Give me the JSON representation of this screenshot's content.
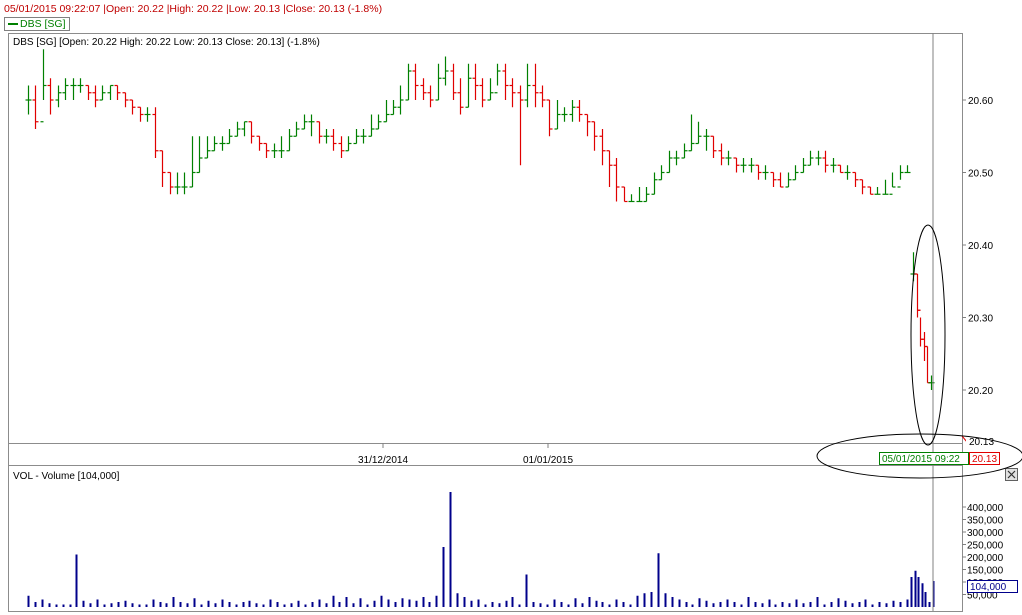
{
  "header": {
    "status_line": "05/01/2015 09:22:07 |Open: 20.22 |High: 20.22 |Low: 20.13 |Close: 20.13 (-1.8%)",
    "legend_label": "DBS [SG]"
  },
  "price_pane": {
    "info": "DBS [SG] [Open: 20.22  High: 20.22  Low: 20.13  Close: 20.13] (-1.8%)",
    "last_price_label": "20.13",
    "cursor_price_label": "20.13",
    "cursor_time_label": "05/01/2015 09:22"
  },
  "volume_pane": {
    "info": "VOL - Volume [104,000]",
    "last_volume_label": "104,000"
  },
  "colors": {
    "up": "#008000",
    "down": "#e00000",
    "volume": "#00008b",
    "annotation": "#000000"
  },
  "chart_data": [
    {
      "type": "ohlc",
      "title": "DBS [SG]",
      "ylim": [
        20.13,
        20.67
      ],
      "yticks": [
        "20.60",
        "20.50",
        "20.40",
        "20.30",
        "20.20",
        "20.13"
      ],
      "x_labels": [
        "31/12/2014",
        "01/01/2015"
      ],
      "session_1": {
        "closes": [
          20.6,
          20.57,
          20.62,
          20.6,
          20.61,
          20.62,
          20.62,
          20.62,
          20.61,
          20.6,
          20.61,
          20.62,
          20.61,
          20.6,
          20.59,
          20.58,
          20.58,
          20.53,
          20.5,
          20.48,
          20.48,
          20.48,
          20.5,
          20.52,
          20.53,
          20.54,
          20.54,
          20.55,
          20.56,
          20.57,
          20.55,
          20.54,
          20.53,
          20.53,
          20.53,
          20.55,
          20.56,
          20.57,
          20.57,
          20.55,
          20.55,
          20.54,
          20.53,
          20.54,
          20.55,
          20.55,
          20.56,
          20.57,
          20.58,
          20.59,
          20.6,
          20.64,
          20.62,
          20.61,
          20.6,
          20.63,
          20.64,
          20.61,
          20.59,
          20.63,
          20.62,
          20.6,
          20.61,
          20.64,
          20.62,
          20.61,
          20.6,
          20.62,
          20.61,
          20.6,
          20.56,
          20.58,
          20.58,
          20.59,
          20.58,
          20.57,
          20.55,
          20.53,
          20.51,
          20.48,
          20.46,
          20.46,
          20.46,
          20.47,
          20.49,
          20.5,
          20.52,
          20.52,
          20.53,
          20.54,
          20.55,
          20.55,
          20.53,
          20.52,
          20.52,
          20.51,
          20.51,
          20.51,
          20.5,
          20.5,
          20.49,
          20.48,
          20.49,
          20.5,
          20.51,
          20.52,
          20.52,
          20.51,
          20.51,
          20.5,
          20.5,
          20.49,
          20.48,
          20.47,
          20.47,
          20.47,
          20.48,
          20.5,
          20.5
        ],
        "highs": [
          20.62,
          20.62,
          20.67,
          20.63,
          20.62,
          20.63,
          20.63,
          20.63,
          20.62,
          20.62,
          20.62,
          20.62,
          20.62,
          20.61,
          20.6,
          20.59,
          20.59,
          20.59,
          20.53,
          20.5,
          20.5,
          20.5,
          20.55,
          20.55,
          20.55,
          20.55,
          20.55,
          20.56,
          20.57,
          20.57,
          20.57,
          20.55,
          20.54,
          20.54,
          20.55,
          20.56,
          20.57,
          20.58,
          20.58,
          20.57,
          20.56,
          20.56,
          20.55,
          20.55,
          20.56,
          20.56,
          20.58,
          20.58,
          20.6,
          20.6,
          20.62,
          20.65,
          20.65,
          20.63,
          20.62,
          20.65,
          20.66,
          20.65,
          20.63,
          20.65,
          20.65,
          20.63,
          20.63,
          20.65,
          20.65,
          20.63,
          20.62,
          20.65,
          20.65,
          20.62,
          20.6,
          20.6,
          20.59,
          20.6,
          20.6,
          20.58,
          20.57,
          20.56,
          20.53,
          20.52,
          20.48,
          20.47,
          20.48,
          20.48,
          20.5,
          20.51,
          20.53,
          20.53,
          20.54,
          20.58,
          20.57,
          20.56,
          20.55,
          20.54,
          20.53,
          20.52,
          20.52,
          20.52,
          20.51,
          20.51,
          20.5,
          20.5,
          20.5,
          20.51,
          20.52,
          20.53,
          20.53,
          20.53,
          20.52,
          20.51,
          20.51,
          20.5,
          20.49,
          20.48,
          20.48,
          20.49,
          20.5,
          20.51,
          20.51
        ],
        "lows": [
          20.58,
          20.56,
          20.6,
          20.58,
          20.59,
          20.6,
          20.6,
          20.61,
          20.6,
          20.59,
          20.6,
          20.6,
          20.6,
          20.59,
          20.58,
          20.57,
          20.57,
          20.52,
          20.48,
          20.47,
          20.47,
          20.47,
          20.48,
          20.5,
          20.52,
          20.53,
          20.53,
          20.54,
          20.55,
          20.55,
          20.54,
          20.53,
          20.52,
          20.52,
          20.52,
          20.53,
          20.55,
          20.56,
          20.55,
          20.54,
          20.54,
          20.53,
          20.52,
          20.53,
          20.54,
          20.54,
          20.55,
          20.56,
          20.57,
          20.58,
          20.58,
          20.6,
          20.6,
          20.6,
          20.59,
          20.6,
          20.62,
          20.6,
          20.58,
          20.59,
          20.6,
          20.59,
          20.6,
          20.62,
          20.6,
          20.59,
          20.51,
          20.59,
          20.59,
          20.59,
          20.55,
          20.56,
          20.57,
          20.57,
          20.57,
          20.55,
          20.53,
          20.51,
          20.48,
          20.46,
          20.46,
          20.46,
          20.46,
          20.46,
          20.47,
          20.49,
          20.5,
          20.51,
          20.52,
          20.53,
          20.54,
          20.53,
          20.52,
          20.51,
          20.51,
          20.5,
          20.5,
          20.5,
          20.49,
          20.49,
          20.48,
          20.48,
          20.48,
          20.49,
          20.5,
          20.51,
          20.51,
          20.5,
          20.5,
          20.5,
          20.49,
          20.48,
          20.47,
          20.47,
          20.47,
          20.47,
          20.48,
          20.49,
          20.5
        ]
      },
      "session_2": {
        "closes": [
          20.36,
          20.31,
          20.27,
          20.26,
          20.21,
          20.21
        ],
        "highs": [
          20.39,
          20.36,
          20.3,
          20.28,
          20.26,
          20.22
        ],
        "lows": [
          20.35,
          20.3,
          20.26,
          20.24,
          20.21,
          20.2
        ]
      },
      "last_close": 20.13
    },
    {
      "type": "bar",
      "title": "VOL - Volume [104,000]",
      "ylim": [
        0,
        450000
      ],
      "yticks": [
        "400,000",
        "350,000",
        "300,000",
        "250,000",
        "200,000",
        "150,000",
        "100,000",
        "50,000"
      ],
      "session_1_values": [
        45000,
        20000,
        30000,
        15000,
        10000,
        10000,
        10000,
        210000,
        25000,
        15000,
        30000,
        10000,
        15000,
        20000,
        25000,
        15000,
        10000,
        10000,
        30000,
        20000,
        15000,
        40000,
        20000,
        15000,
        35000,
        10000,
        25000,
        15000,
        30000,
        20000,
        10000,
        20000,
        25000,
        15000,
        10000,
        30000,
        20000,
        10000,
        15000,
        25000,
        10000,
        20000,
        30000,
        15000,
        45000,
        20000,
        40000,
        15000,
        35000,
        10000,
        25000,
        45000,
        30000,
        20000,
        35000,
        30000,
        25000,
        40000,
        20000,
        45000,
        240000,
        460000,
        55000,
        40000,
        25000,
        30000,
        10000,
        20000,
        15000,
        25000,
        40000,
        10000,
        130000,
        20000,
        15000,
        10000,
        30000,
        20000,
        10000,
        35000,
        15000,
        40000,
        25000,
        20000,
        10000,
        30000,
        20000,
        10000,
        45000,
        55000,
        60000,
        215000,
        55000,
        40000,
        30000,
        20000,
        10000,
        35000,
        25000,
        15000,
        20000,
        30000,
        20000,
        10000,
        40000,
        20000,
        15000,
        30000,
        10000,
        20000,
        15000,
        30000,
        15000,
        20000,
        40000,
        10000,
        20000,
        35000,
        25000,
        15000,
        20000,
        30000,
        10000,
        20000,
        15000,
        25000,
        20000,
        30000
      ],
      "session_2_values": [
        120000,
        145000,
        120000,
        95000,
        60000,
        20000,
        104000
      ]
    }
  ]
}
